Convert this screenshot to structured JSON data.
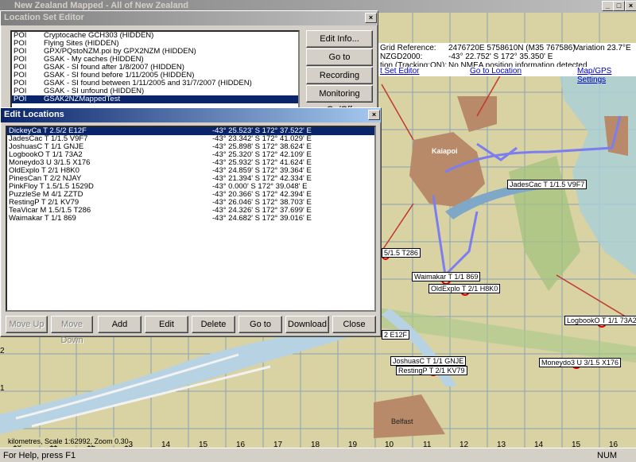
{
  "app": {
    "title": "New Zealand Mapped - All of New Zealand",
    "status": "For Help, press F1",
    "num_indicator": "NUM"
  },
  "gps": {
    "grid_ref_label": "Grid Reference:",
    "grid_ref_value": "2476720E 5758610N (M35 767586)",
    "variation": "Variation 23.7°E",
    "nzgd_label": "NZGD2000:",
    "nzgd_value": "-43° 22.752' S  172° 35.350' E",
    "tracking_label": "tion (Tracking:ON):",
    "tracking_value": "No NMEA position information detected",
    "link_set_editor": "t Set Editor",
    "link_goto": "Go to Location",
    "link_settings": "Map/GPS Settings"
  },
  "map": {
    "labels": {
      "kaiapoi": "Kaiapoi",
      "jadescac": "JadesCac T 1/1.5 V9F7",
      "waimakar": "Waimakar T 1/1 869",
      "oldexplo": "OldExplo T 2/1 H8K0",
      "logbook": "LogbookO T 1/1 73A2",
      "moneydo": "Moneydo3 U 3/1.5 X176",
      "joshuas": "JoshuasC T 1/1 GNJE",
      "resting": "RestingP T 2/1 KV79",
      "e12f": "2 E12F",
      "t286": "5/1.5 T286",
      "belfast": "Belfast"
    },
    "scale": "kilometres, Scale 1:62992, Zoom 0.30",
    "ticks": [
      "10",
      "11",
      "12",
      "13",
      "14",
      "15",
      "16",
      "17",
      "18",
      "19",
      "10",
      "11",
      "12",
      "13",
      "14",
      "15",
      "16"
    ],
    "left_ticks": [
      "3",
      "2",
      "1"
    ]
  },
  "lse": {
    "title": "Location Set Editor",
    "items": [
      {
        "type": "POI",
        "name": "Cryptocache GCH303 (HIDDEN)"
      },
      {
        "type": "POI",
        "name": "Flying Sites (HIDDEN)"
      },
      {
        "type": "POI",
        "name": "GPX/PQstoNZM.poi by GPX2NZM (HIDDEN)"
      },
      {
        "type": "POI",
        "name": "GSAK - My caches (HIDDEN)"
      },
      {
        "type": "POI",
        "name": "GSAK - SI found after 1/8/2007 (HIDDEN)"
      },
      {
        "type": "POI",
        "name": "GSAK - SI found before 1/11/2005 (HIDDEN)"
      },
      {
        "type": "POI",
        "name": "GSAK - SI found between 1/11/2005 and 31/7/2007 (HIDDEN)"
      },
      {
        "type": "POI",
        "name": "GSAK - SI unfound (HIDDEN)"
      },
      {
        "type": "POI",
        "name": "GSAK2NZMappedTest"
      }
    ],
    "btn_edit_info": "Edit Info...",
    "btn_goto": "Go to",
    "btn_recording": "Recording On/Off",
    "btn_monitoring": "Monitoring On/Off"
  },
  "el": {
    "title": "Edit Locations",
    "rows": [
      {
        "name": "DickeyCa T 2.5/2 E12F",
        "coord": "-43° 25.523' S  172° 37.522' E"
      },
      {
        "name": "JadesCac T 1/1.5 V9F7",
        "coord": "-43° 23.342' S  172° 41.029' E"
      },
      {
        "name": "JoshuasC T 1/1 GNJE",
        "coord": "-43° 25.898' S  172° 38.624' E"
      },
      {
        "name": "LogbookO T 1/1 73A2",
        "coord": "-43° 25.320' S  172° 42.109' E"
      },
      {
        "name": "Moneydo3 U 3/1.5 X176",
        "coord": "-43° 25.932' S  172° 41.624' E"
      },
      {
        "name": "OldExplo T 2/1 H8K0",
        "coord": "-43° 24.859' S  172° 39.364' E"
      },
      {
        "name": "PinesCan T 2/2 NJAY",
        "coord": "-43° 21.394' S  172° 42.334' E"
      },
      {
        "name": "PinkFloy T 1.5/1.5 1529D",
        "coord": "-43° 0.000' S  172° 39.048' E"
      },
      {
        "name": "PuzzleSe M 4/1 ZZTD",
        "coord": "-43° 20.366' S  172° 42.394' E"
      },
      {
        "name": "RestingP T 2/1 KV79",
        "coord": "-43° 26.046' S  172° 38.703' E"
      },
      {
        "name": "TeaVicar M 1.5/1.5 T286",
        "coord": "-43° 24.326' S  172° 37.699' E"
      },
      {
        "name": "Waimakar T 1/1 869",
        "coord": "-43° 24.682' S  172° 39.016' E"
      }
    ],
    "buttons": {
      "move_up": "Move Up",
      "move_down": "Move Down",
      "add": "Add",
      "edit": "Edit",
      "delete": "Delete",
      "goto": "Go to",
      "download": "Download",
      "close": "Close"
    }
  }
}
